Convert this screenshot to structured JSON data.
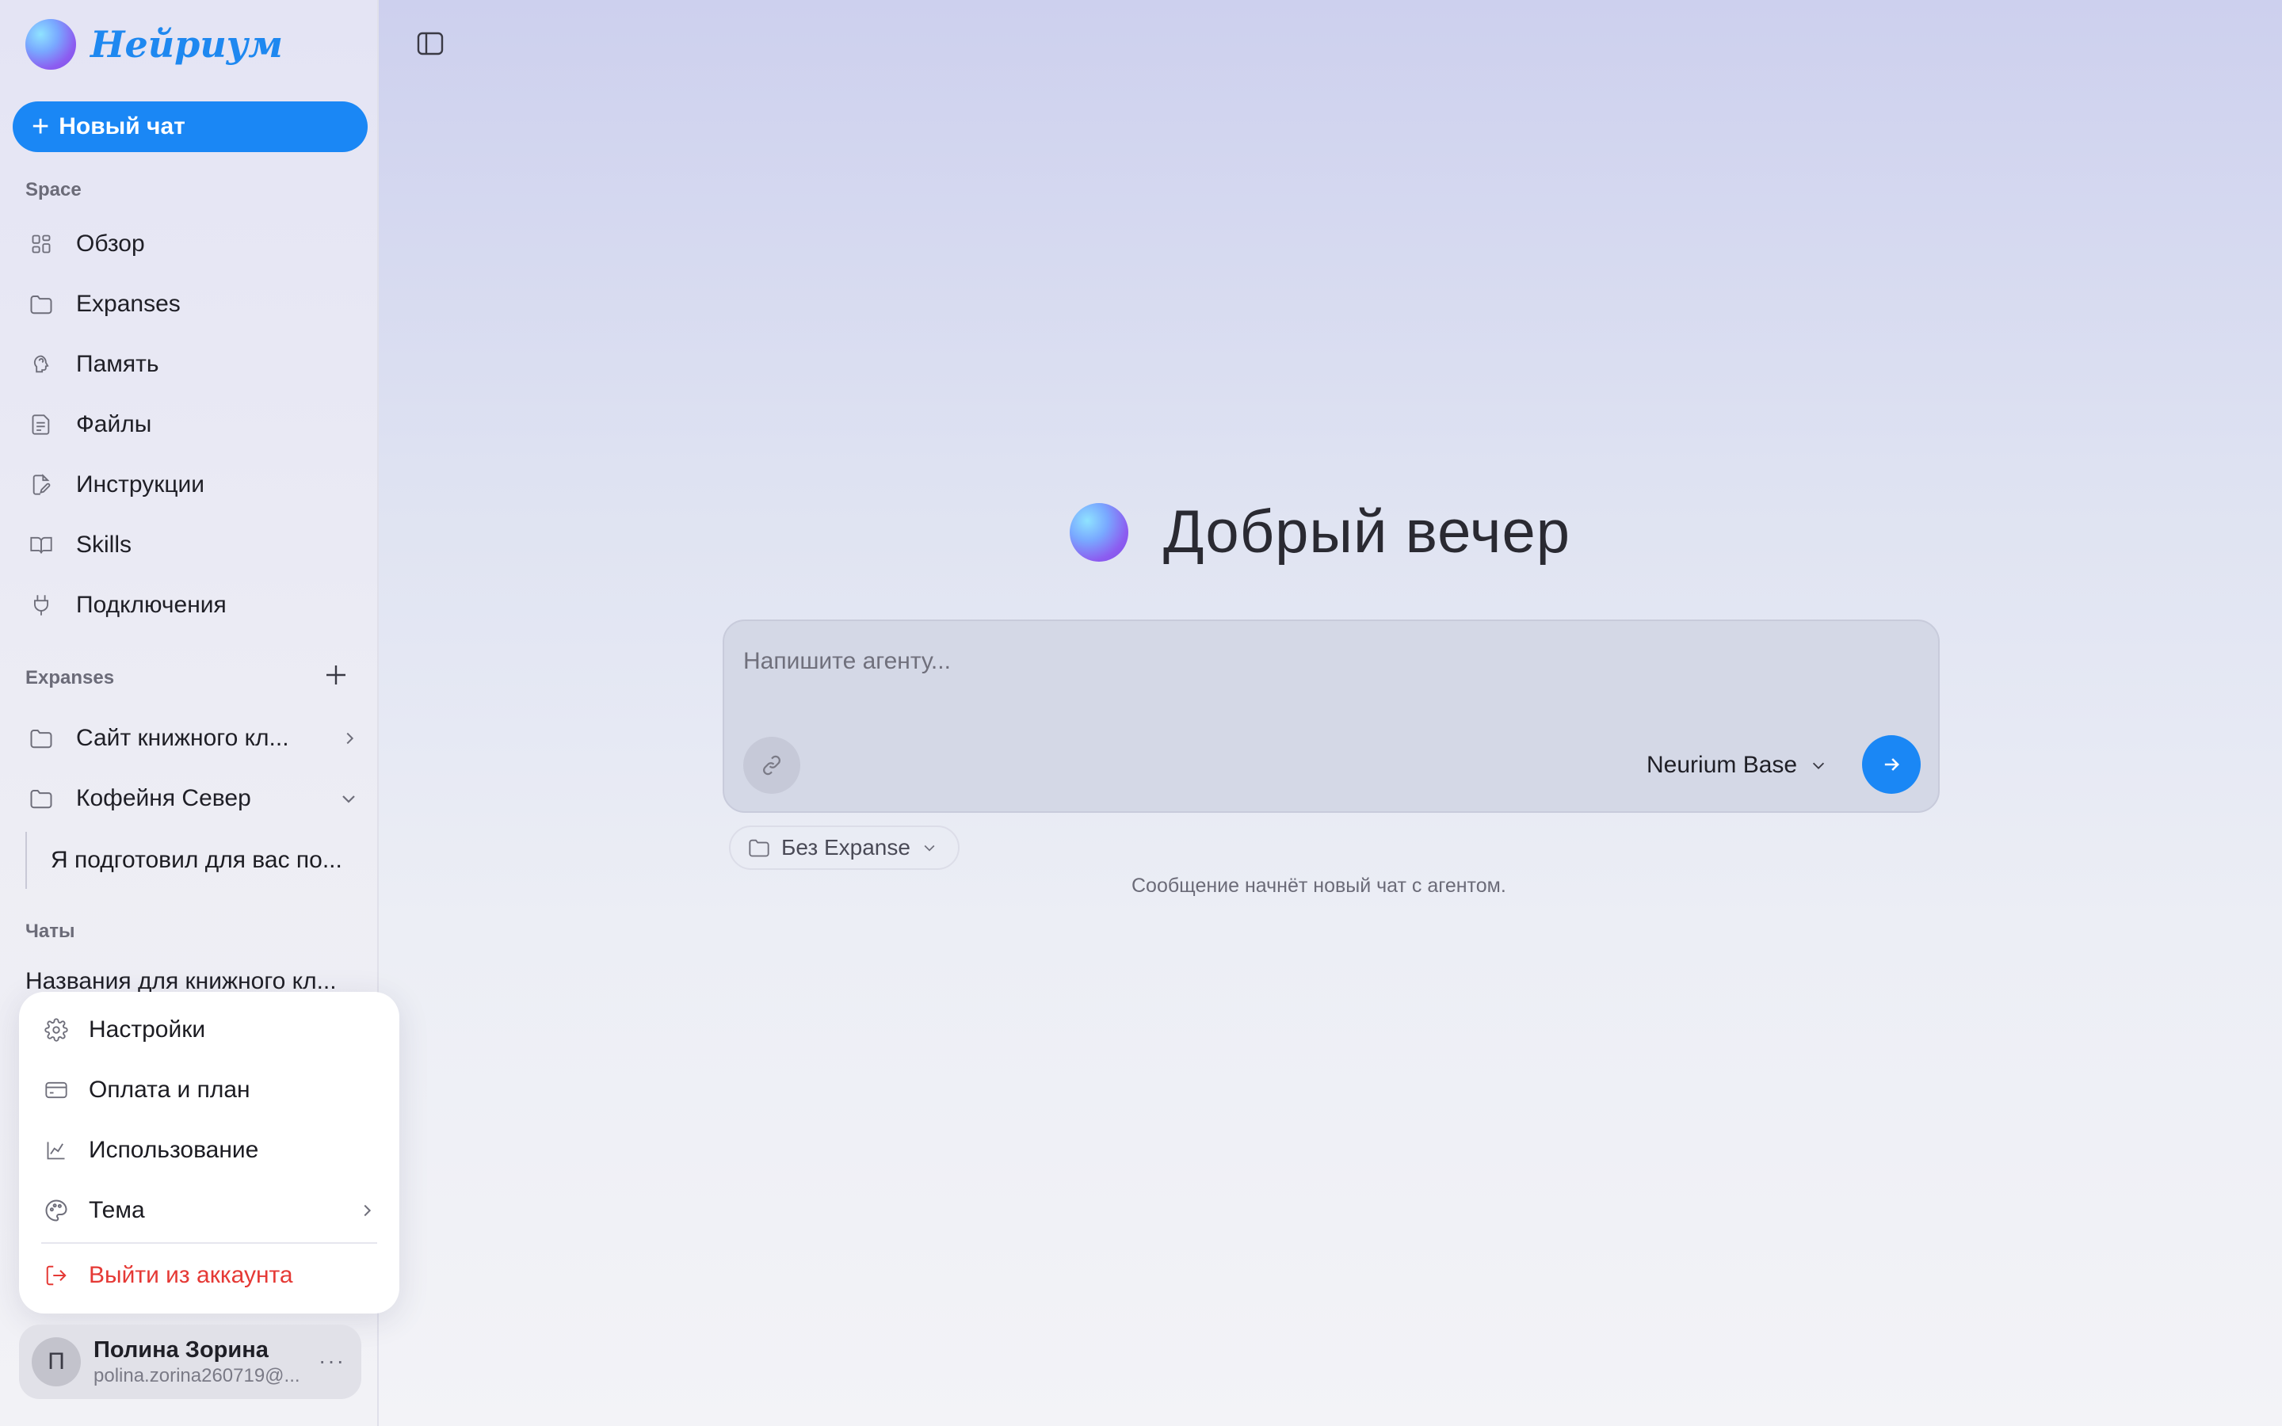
{
  "app": {
    "logo_text": "Нейриум"
  },
  "sidebar": {
    "new_chat_label": "Новый чат",
    "space_label": "Space",
    "space_items": [
      {
        "label": "Обзор",
        "icon": "grid-icon"
      },
      {
        "label": "Expanses",
        "icon": "folder-icon"
      },
      {
        "label": "Память",
        "icon": "brain-icon"
      },
      {
        "label": "Файлы",
        "icon": "file-icon"
      },
      {
        "label": "Инструкции",
        "icon": "edit-document-icon"
      },
      {
        "label": "Skills",
        "icon": "book-icon"
      },
      {
        "label": "Подключения",
        "icon": "plug-icon"
      }
    ],
    "expanses_label": "Expanses",
    "expanses": [
      {
        "label": "Сайт книжного кл...",
        "state": "collapsed"
      },
      {
        "label": "Кофейня Север",
        "state": "expanded"
      }
    ],
    "expanse_thread": "Я подготовил для вас по...",
    "chats_label": "Чаты",
    "chats": [
      "Названия для книжного кл..."
    ]
  },
  "menu": {
    "items": [
      {
        "label": "Настройки",
        "icon": "gear-icon"
      },
      {
        "label": "Оплата и план",
        "icon": "card-icon"
      },
      {
        "label": "Использование",
        "icon": "chart-icon"
      },
      {
        "label": "Тема",
        "icon": "palette-icon"
      }
    ],
    "logout_label": "Выйти из аккаунта"
  },
  "user": {
    "initial": "П",
    "name": "Полина Зорина",
    "email": "polina.zorina260719@...",
    "more": "···"
  },
  "main": {
    "greeting": "Добрый вечер",
    "composer_placeholder": "Напишите агенту...",
    "model_label": "Neurium Base",
    "expanse_selector": "Без Expanse",
    "hint": "Сообщение начнёт новый чат с агентом."
  },
  "colors": {
    "accent": "#1a87f5",
    "danger": "#e53935"
  }
}
